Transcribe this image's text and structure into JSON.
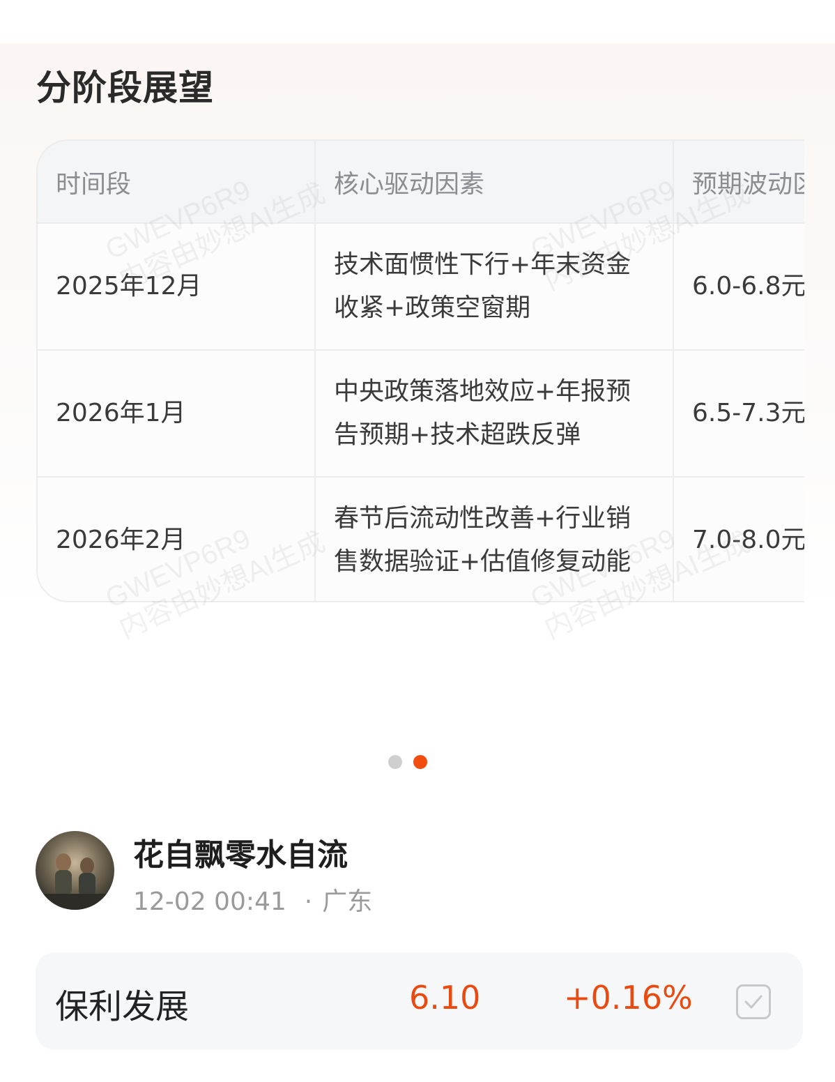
{
  "card": {
    "title": "分阶段展望",
    "table": {
      "headers": [
        "时间段",
        "核心驱动因素",
        "预期波动区间"
      ],
      "rows": [
        {
          "period": "2025年12月",
          "drivers": "技术面惯性下行+年末资金收紧+政策空窗期",
          "range": "6.0-6.8元"
        },
        {
          "period": "2026年1月",
          "drivers": "中央政策落地效应+年报预告预期+技术超跌反弹",
          "range": "6.5-7.3元"
        },
        {
          "period": "2026年2月",
          "drivers": "春节后流动性改善+行业销售数据验证+估值修复动能",
          "range": "7.0-8.0元"
        }
      ]
    },
    "watermark": {
      "line1": "GWEVP6R9",
      "line2": "内容由妙想AI生成"
    }
  },
  "pager": {
    "count": 2,
    "active_index": 1,
    "active_color": "#f04d0f",
    "inactive_color": "#cfcfcf"
  },
  "author": {
    "name": "花自飘零水自流",
    "time": "12-02 00:41",
    "separator": "·",
    "location": "广东",
    "avatar_icon": "avatar-photo"
  },
  "stock": {
    "name": "保利发展",
    "price": "6.10",
    "change": "+0.16%",
    "up_color": "#e84a10",
    "action_icon": "checkbox-checked-icon"
  }
}
